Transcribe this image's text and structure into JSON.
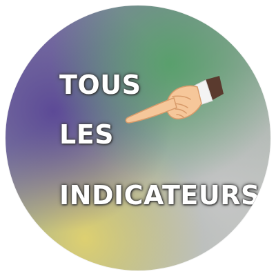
{
  "badge": {
    "line1": "TOUS",
    "line2": "LES",
    "line3": "INDICATEURS",
    "icon": "pointing-hand-icon",
    "colors": {
      "text": "#ffffff",
      "skin": "#f6c79a",
      "sleeve": "#5a3a2e",
      "cuff": "#f2f2f2"
    }
  }
}
